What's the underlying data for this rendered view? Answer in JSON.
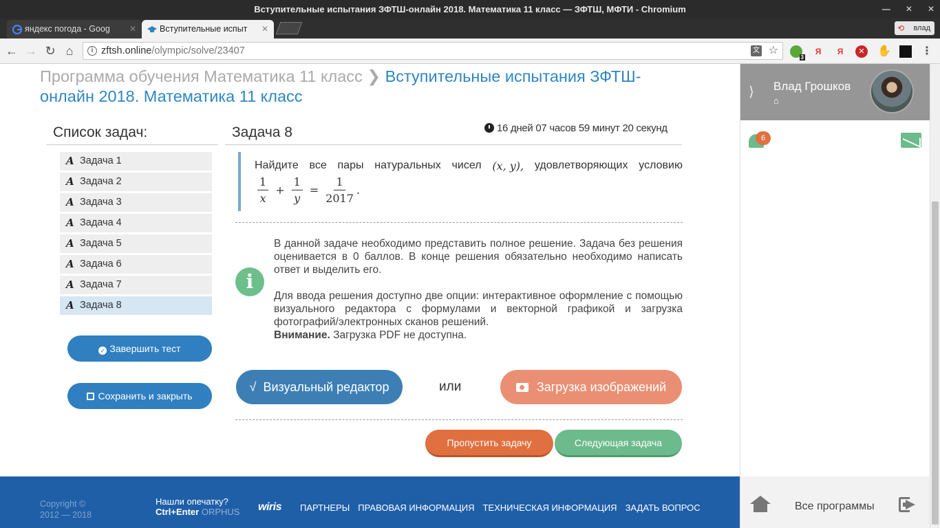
{
  "browser": {
    "window_title": "Вступительные испытания ЗФТШ-онлайн 2018. Математика 11 класс — ЗФТШ, МФТИ - Chromium",
    "tabs": [
      {
        "label": "яндекс погода - Goog"
      },
      {
        "label": "Вступительные испыт"
      }
    ],
    "profile_chip": "влад",
    "url_host": "zftsh.online",
    "url_path": "/olympic/solve/23407",
    "ext_badge": "3"
  },
  "breadcrumb": {
    "parent": "Программа обучения Математика 11 класс",
    "current": "Вступительные испытания ЗФТШ-онлайн 2018. Математика 11 класс"
  },
  "tasklist": {
    "title": "Список задач:",
    "items": [
      "Задача 1",
      "Задача 2",
      "Задача 3",
      "Задача 4",
      "Задача 5",
      "Задача 6",
      "Задача 7",
      "Задача 8"
    ],
    "active_index": 7
  },
  "actions": {
    "finish": "Завершить тест",
    "save_close": "Сохранить и закрыть"
  },
  "task": {
    "title": "Задача 8",
    "timer": "16 дней 07 часов 59 минут 20 секунд",
    "problem_words": [
      "Найдите",
      "все",
      "пары",
      "натуральных",
      "чисел"
    ],
    "problem_pair": "(x, y),",
    "problem_tail": [
      "удовлетворяющих",
      "условию"
    ],
    "formula": {
      "n1": "1",
      "d1": "x",
      "plus": "+",
      "n2": "1",
      "d2": "y",
      "eq": "=",
      "n3": "1",
      "d3": "2017",
      "dot": "."
    }
  },
  "notice": {
    "p1": "В данной задаче необходимо представить полное решение. Задача без решения оценивается в 0 баллов. В конце решения обязательно необходимо написать ответ и выделить его.",
    "p2": "Для ввода решения доступно две опции: интерактивное оформление с помощью визуального редактора с формулами и векторной графикой и загрузка фотографий/электронных сканов решений.",
    "warn_bold": "Внимание.",
    "warn_text": "Загрузка PDF не доступна."
  },
  "solution": {
    "editor": "Визуальный редактор",
    "or": "или",
    "upload": "Загрузка изображений"
  },
  "nav": {
    "skip": "Пропустить задачу",
    "next": "Следующая задача"
  },
  "footer": {
    "copyright_line1": "Copyright ©",
    "copyright_line2": "2012 — 2018",
    "typo_line1": "Нашли опечатку?",
    "typo_keys": "Ctrl+Enter",
    "typo_orphus": "ORPHUS",
    "wiris": "wiris",
    "links": [
      "ПАРТНЕРЫ",
      "ПРАВОВАЯ ИНФОРМАЦИЯ",
      "ТЕХНИЧЕСКАЯ ИНФОРМАЦИЯ",
      "ЗАДАТЬ ВОПРОС"
    ]
  },
  "sidebar": {
    "user_name": "Влад Грошков",
    "notifications": "6",
    "all_programs": "Все программы"
  },
  "colors": {
    "accent_blue": "#2f7fc1",
    "footer_blue": "#1f5fa8",
    "orange": "#e0703f",
    "green": "#6dba8c"
  }
}
